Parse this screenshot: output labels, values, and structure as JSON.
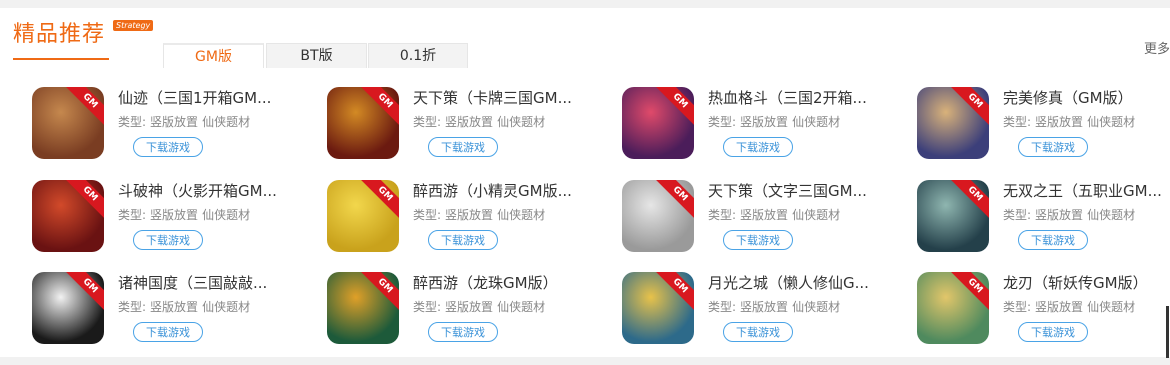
{
  "section": {
    "title": "精品推荐",
    "badge": "Strategy",
    "more": "更多",
    "tabs": [
      {
        "label": "GM版",
        "active": true
      },
      {
        "label": "BT版",
        "active": false
      },
      {
        "label": "0.1折",
        "active": false
      }
    ]
  },
  "gm_tag": "GM",
  "games": [
    {
      "name": "仙迹（三国1开箱GM...",
      "type_label": "类型:",
      "type": "竖版放置",
      "genre": "仙侠题材",
      "download": "下载游戏",
      "colors": [
        "#7a3d22",
        "#c5884e"
      ]
    },
    {
      "name": "天下策（卡牌三国GM...",
      "type_label": "类型:",
      "type": "竖版放置",
      "genre": "仙侠题材",
      "download": "下载游戏",
      "colors": [
        "#6b1a10",
        "#d38a24"
      ]
    },
    {
      "name": "热血格斗（三国2开箱...",
      "type_label": "类型:",
      "type": "竖版放置",
      "genre": "仙侠题材",
      "download": "下载游戏",
      "colors": [
        "#4b1d5a",
        "#e04a6a"
      ]
    },
    {
      "name": "完美修真（GM版）",
      "type_label": "类型:",
      "type": "竖版放置",
      "genre": "仙侠题材",
      "download": "下载游戏",
      "colors": [
        "#3c3f7a",
        "#d9b27a"
      ]
    },
    {
      "name": "斗破神（火影开箱GM...",
      "type_label": "类型:",
      "type": "竖版放置",
      "genre": "仙侠题材",
      "download": "下载游戏",
      "colors": [
        "#6a1212",
        "#d24a2a"
      ]
    },
    {
      "name": "醉西游（小精灵GM版...",
      "type_label": "类型:",
      "type": "竖版放置",
      "genre": "仙侠题材",
      "download": "下载游戏",
      "colors": [
        "#c9a21c",
        "#f2d74c"
      ]
    },
    {
      "name": "天下策（文字三国GM...",
      "type_label": "类型:",
      "type": "竖版放置",
      "genre": "仙侠题材",
      "download": "下载游戏",
      "colors": [
        "#9a9a9a",
        "#e6e6e6"
      ]
    },
    {
      "name": "无双之王（五职业GM...",
      "type_label": "类型:",
      "type": "竖版放置",
      "genre": "仙侠题材",
      "download": "下载游戏",
      "colors": [
        "#24404a",
        "#8fb6b0"
      ]
    },
    {
      "name": "诸神国度（三国敲敲...",
      "type_label": "类型:",
      "type": "竖版放置",
      "genre": "仙侠题材",
      "download": "下载游戏",
      "colors": [
        "#1a1a1a",
        "#f2f2f2"
      ]
    },
    {
      "name": "醉西游（龙珠GM版）",
      "type_label": "类型:",
      "type": "竖版放置",
      "genre": "仙侠题材",
      "download": "下载游戏",
      "colors": [
        "#1d5a3a",
        "#e0a028"
      ]
    },
    {
      "name": "月光之城（懒人修仙G...",
      "type_label": "类型:",
      "type": "竖版放置",
      "genre": "仙侠题材",
      "download": "下载游戏",
      "colors": [
        "#2d6a8a",
        "#e8c24a"
      ]
    },
    {
      "name": "龙刃（斩妖传GM版）",
      "type_label": "类型:",
      "type": "竖版放置",
      "genre": "仙侠题材",
      "download": "下载游戏",
      "colors": [
        "#4f8a5e",
        "#e2c66a"
      ]
    }
  ]
}
